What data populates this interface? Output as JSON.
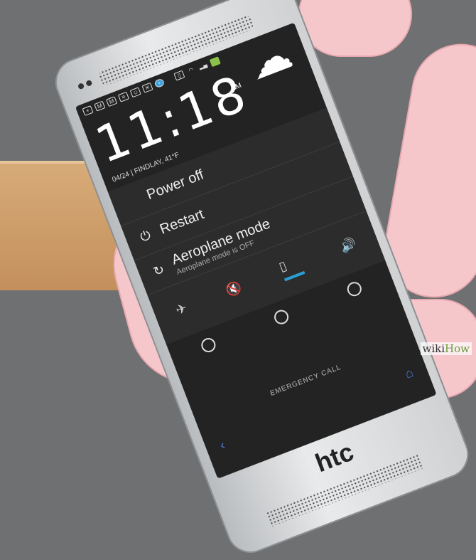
{
  "status_icons": [
    "bookmark-plus",
    "gmail",
    "gmail",
    "keyboard",
    "android",
    "tools",
    "plus-circle",
    "vibrate",
    "wifi",
    "signal",
    "battery"
  ],
  "clock": {
    "time": "11:18",
    "ampm": "AM",
    "date": "04/24",
    "location": "FINDLAY, 41°F"
  },
  "weather_icon": "cloud-rain",
  "menu": {
    "power_off": "Power off",
    "restart": "Restart",
    "aeroplane": "Aeroplane mode",
    "aeroplane_sub": "Aeroplane mode is OFF"
  },
  "sound_modes": [
    "silent",
    "vibrate",
    "sound"
  ],
  "emergency": "EMERGENCY CALL",
  "brand": "htc",
  "watermark": {
    "a": "wiki",
    "b": "How"
  },
  "colors": {
    "accent": "#2a9fd6",
    "nav": "#4a7bdc"
  }
}
